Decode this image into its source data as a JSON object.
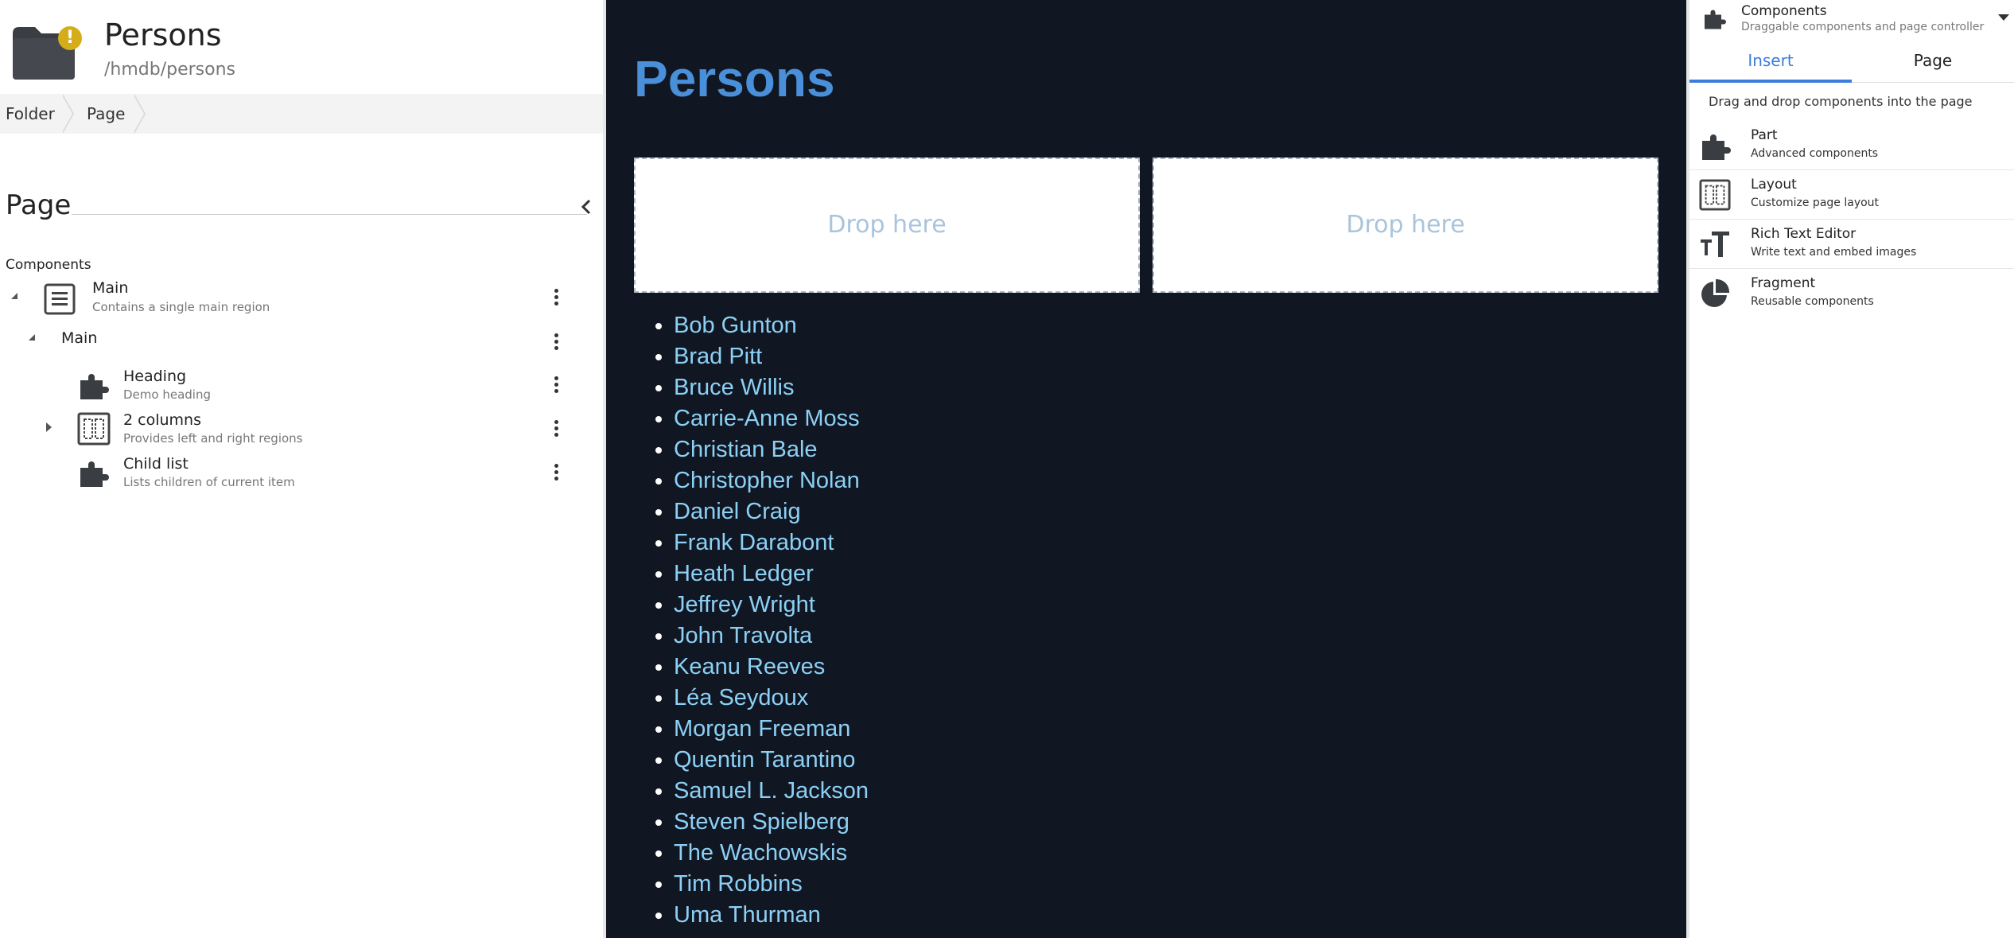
{
  "left_panel": {
    "title": "Persons",
    "path": "/hmdb/persons",
    "warning_badge": "!",
    "breadcrumbs": [
      "Folder",
      "Page"
    ],
    "section_title": "Page",
    "components_label": "Components",
    "tree": [
      {
        "title": "Main",
        "subtitle": "Contains a single main region",
        "icon": "document-icon"
      },
      {
        "title": "Main",
        "subtitle": "",
        "icon": ""
      },
      {
        "title": "Heading",
        "subtitle": "Demo heading",
        "icon": "puzzle-icon"
      },
      {
        "title": "2 columns",
        "subtitle": "Provides left and right regions",
        "icon": "layout-icon"
      },
      {
        "title": "Child list",
        "subtitle": "Lists children of current item",
        "icon": "puzzle-icon"
      }
    ]
  },
  "preview": {
    "heading": "Persons",
    "drop_left": "Drop here",
    "drop_right": "Drop here",
    "persons": [
      "Bob Gunton",
      "Brad Pitt",
      "Bruce Willis",
      "Carrie-Anne Moss",
      "Christian Bale",
      "Christopher Nolan",
      "Daniel Craig",
      "Frank Darabont",
      "Heath Ledger",
      "Jeffrey Wright",
      "John Travolta",
      "Keanu Reeves",
      "Léa Seydoux",
      "Morgan Freeman",
      "Quentin Tarantino",
      "Samuel L. Jackson",
      "Steven Spielberg",
      "The Wachowskis",
      "Tim Robbins",
      "Uma Thurman"
    ]
  },
  "right_panel": {
    "title": "Components",
    "subtitle": "Draggable components and page controller",
    "tabs": [
      "Insert",
      "Page"
    ],
    "hint": "Drag and drop components into the page",
    "items": [
      {
        "title": "Part",
        "subtitle": "Advanced components",
        "icon": "puzzle-icon"
      },
      {
        "title": "Layout",
        "subtitle": "Customize page layout",
        "icon": "layout-icon"
      },
      {
        "title": "Rich Text Editor",
        "subtitle": "Write text and embed images",
        "icon": "text-icon"
      },
      {
        "title": "Fragment",
        "subtitle": "Reusable components",
        "icon": "pie-icon"
      }
    ]
  },
  "colors": {
    "accent": "#3b7ddd",
    "preview_bg": "#111722",
    "heading": "#4a8fd9",
    "link": "#8cd0f6",
    "warning": "#d4ad18"
  }
}
